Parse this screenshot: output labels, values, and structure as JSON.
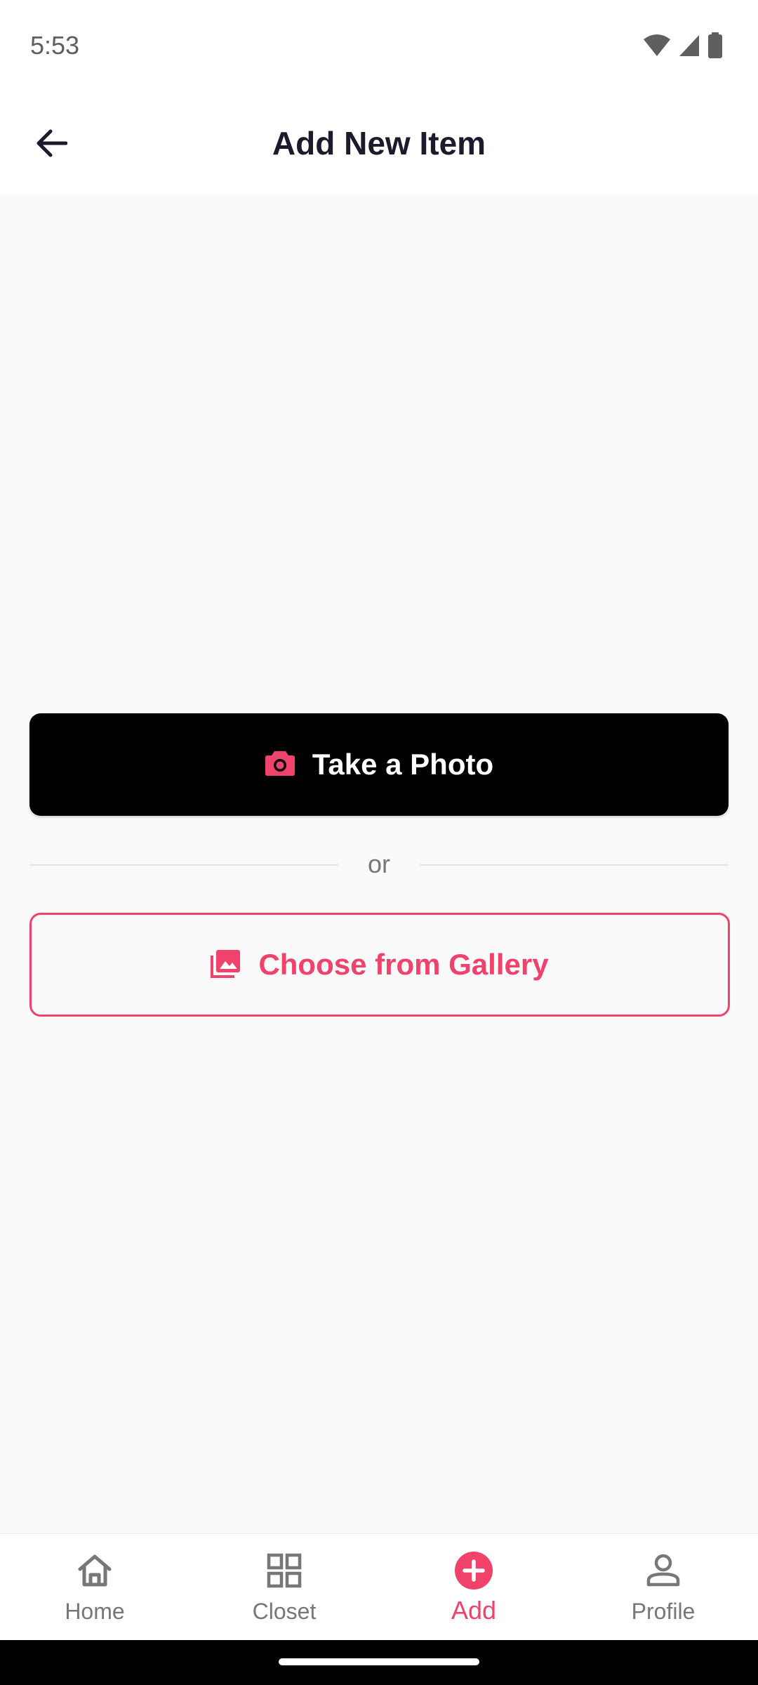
{
  "status_bar": {
    "time": "5:53",
    "icons": [
      "wifi-icon",
      "signal-icon",
      "battery-icon"
    ]
  },
  "app_bar": {
    "title": "Add New Item",
    "back_icon": "arrow-back-icon"
  },
  "actions": {
    "take_photo": {
      "label": "Take a Photo",
      "icon": "camera-icon"
    },
    "divider_text": "or",
    "gallery": {
      "label": "Choose from Gallery",
      "icon": "gallery-icon"
    }
  },
  "bottom_nav": {
    "items": [
      {
        "label": "Home",
        "icon": "home-icon",
        "active": false
      },
      {
        "label": "Closet",
        "icon": "grid-icon",
        "active": false
      },
      {
        "label": "Add",
        "icon": "add-circle-icon",
        "active": true
      },
      {
        "label": "Profile",
        "icon": "person-icon",
        "active": false
      }
    ]
  },
  "colors": {
    "accent": "#f0426b",
    "primary_button": "#000000",
    "background": "#fafafa",
    "title_text": "#1c1b2e",
    "muted_text": "#777777"
  }
}
